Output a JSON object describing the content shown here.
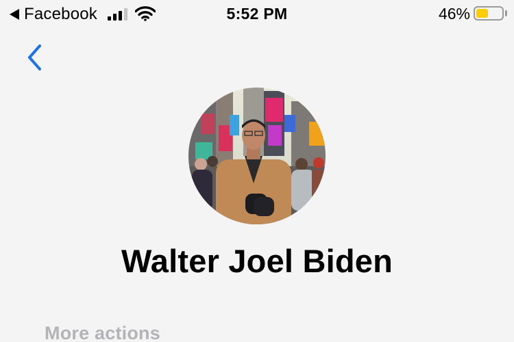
{
  "status_bar": {
    "back_app": "Facebook",
    "time": "5:52 PM",
    "battery_percent": "46%",
    "battery_level": 0.46,
    "battery_color": "#ffcc00",
    "signal_bars_filled": 3,
    "signal_bars_total": 4
  },
  "nav": {
    "back_icon": "chevron-left-icon",
    "accent_color": "#1a73e8"
  },
  "profile": {
    "name": "Walter Joel Biden"
  },
  "sections": {
    "more_actions": "More actions"
  }
}
